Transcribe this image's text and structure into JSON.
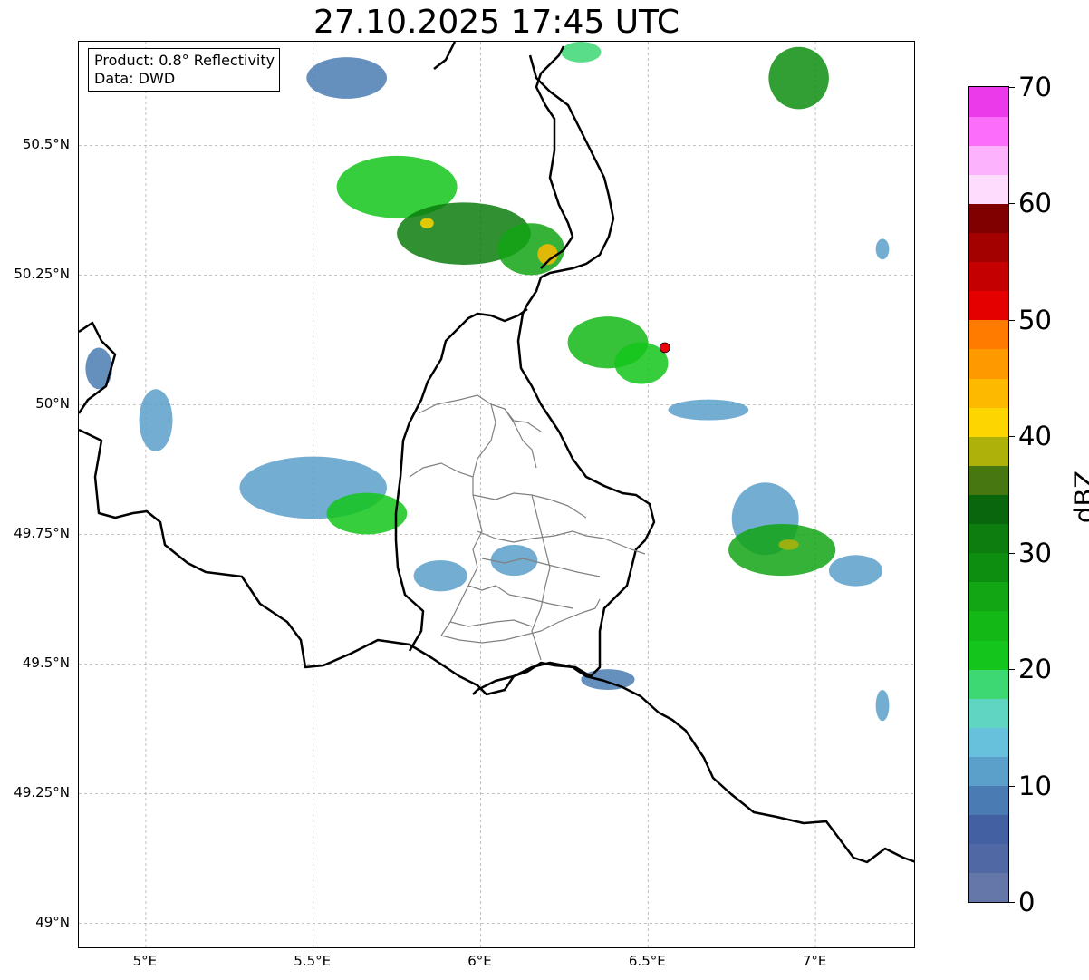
{
  "title": "27.10.2025 17:45 UTC",
  "info_box": {
    "product_line": "Product: 0.8° Reflectivity",
    "data_line": "Data: DWD"
  },
  "map": {
    "lon_range": [
      4.8,
      7.3
    ],
    "lat_range": [
      48.95,
      50.7
    ],
    "grid": true,
    "x_ticks": [
      {
        "value": 5.0,
        "label": "5°E"
      },
      {
        "value": 5.5,
        "label": "5.5°E"
      },
      {
        "value": 6.0,
        "label": "6°E"
      },
      {
        "value": 6.5,
        "label": "6.5°E"
      },
      {
        "value": 7.0,
        "label": "7°E"
      }
    ],
    "y_ticks": [
      {
        "value": 50.5,
        "label": "50.5°N"
      },
      {
        "value": 50.25,
        "label": "50.25°N"
      },
      {
        "value": 50.0,
        "label": "50°N"
      },
      {
        "value": 49.75,
        "label": "49.75°N"
      },
      {
        "value": 49.5,
        "label": "49.5°N"
      },
      {
        "value": 49.25,
        "label": "49.25°N"
      },
      {
        "value": 49.0,
        "label": "49°N"
      }
    ],
    "radar_site": {
      "lon": 6.55,
      "lat": 50.11,
      "color": "#e8000b"
    },
    "echo_cells": [
      {
        "lon": 6.3,
        "lat": 50.68,
        "rx": 0.06,
        "ry": 0.02,
        "dbz": 18
      },
      {
        "lon": 6.95,
        "lat": 50.63,
        "rx": 0.09,
        "ry": 0.06,
        "dbz": 28
      },
      {
        "lon": 5.6,
        "lat": 50.63,
        "rx": 0.12,
        "ry": 0.04,
        "dbz": 8
      },
      {
        "lon": 5.75,
        "lat": 50.42,
        "rx": 0.18,
        "ry": 0.06,
        "dbz": 22
      },
      {
        "lon": 5.95,
        "lat": 50.33,
        "rx": 0.2,
        "ry": 0.06,
        "dbz": 30
      },
      {
        "lon": 6.15,
        "lat": 50.3,
        "rx": 0.1,
        "ry": 0.05,
        "dbz": 26
      },
      {
        "lon": 6.2,
        "lat": 50.29,
        "rx": 0.03,
        "ry": 0.02,
        "dbz": 44
      },
      {
        "lon": 5.84,
        "lat": 50.35,
        "rx": 0.02,
        "ry": 0.01,
        "dbz": 42
      },
      {
        "lon": 6.38,
        "lat": 50.12,
        "rx": 0.12,
        "ry": 0.05,
        "dbz": 24
      },
      {
        "lon": 6.48,
        "lat": 50.08,
        "rx": 0.08,
        "ry": 0.04,
        "dbz": 20
      },
      {
        "lon": 6.68,
        "lat": 49.99,
        "rx": 0.12,
        "ry": 0.02,
        "dbz": 10
      },
      {
        "lon": 5.03,
        "lat": 49.97,
        "rx": 0.05,
        "ry": 0.06,
        "dbz": 10
      },
      {
        "lon": 4.86,
        "lat": 50.07,
        "rx": 0.04,
        "ry": 0.04,
        "dbz": 8
      },
      {
        "lon": 5.5,
        "lat": 49.84,
        "rx": 0.22,
        "ry": 0.06,
        "dbz": 12
      },
      {
        "lon": 5.66,
        "lat": 49.79,
        "rx": 0.12,
        "ry": 0.04,
        "dbz": 20
      },
      {
        "lon": 5.88,
        "lat": 49.67,
        "rx": 0.08,
        "ry": 0.03,
        "dbz": 10
      },
      {
        "lon": 6.1,
        "lat": 49.7,
        "rx": 0.07,
        "ry": 0.03,
        "dbz": 12
      },
      {
        "lon": 6.85,
        "lat": 49.78,
        "rx": 0.1,
        "ry": 0.07,
        "dbz": 12
      },
      {
        "lon": 6.9,
        "lat": 49.72,
        "rx": 0.16,
        "ry": 0.05,
        "dbz": 26
      },
      {
        "lon": 6.92,
        "lat": 49.73,
        "rx": 0.03,
        "ry": 0.01,
        "dbz": 38
      },
      {
        "lon": 7.12,
        "lat": 49.68,
        "rx": 0.08,
        "ry": 0.03,
        "dbz": 12
      },
      {
        "lon": 6.38,
        "lat": 49.47,
        "rx": 0.08,
        "ry": 0.02,
        "dbz": 8
      },
      {
        "lon": 7.2,
        "lat": 49.42,
        "rx": 0.02,
        "ry": 0.03,
        "dbz": 10
      },
      {
        "lon": 7.2,
        "lat": 50.3,
        "rx": 0.02,
        "ry": 0.02,
        "dbz": 10
      }
    ]
  },
  "colorbar": {
    "label": "dBZ",
    "min": 0,
    "max": 70,
    "step": 2.5,
    "colors": [
      "#6577a8",
      "#5068a3",
      "#4360a2",
      "#4a7cb3",
      "#5ba0ca",
      "#67c1dc",
      "#5fd5c2",
      "#3dd774",
      "#14c61b",
      "#13b716",
      "#12a514",
      "#0e8e10",
      "#0c7d0e",
      "#0a660c",
      "#477711",
      "#afb10b",
      "#fdd500",
      "#fdb800",
      "#fe9900",
      "#fe7b00",
      "#e50000",
      "#c50000",
      "#a30000",
      "#800000",
      "#fddcfd",
      "#fdb2fd",
      "#fc6dfc",
      "#ea3aea"
    ],
    "ticks": [
      {
        "value": 0,
        "label": "0"
      },
      {
        "value": 10,
        "label": "10"
      },
      {
        "value": 20,
        "label": "20"
      },
      {
        "value": 30,
        "label": "30"
      },
      {
        "value": 40,
        "label": "40"
      },
      {
        "value": 50,
        "label": "50"
      },
      {
        "value": 60,
        "label": "60"
      },
      {
        "value": 70,
        "label": "70"
      }
    ]
  }
}
